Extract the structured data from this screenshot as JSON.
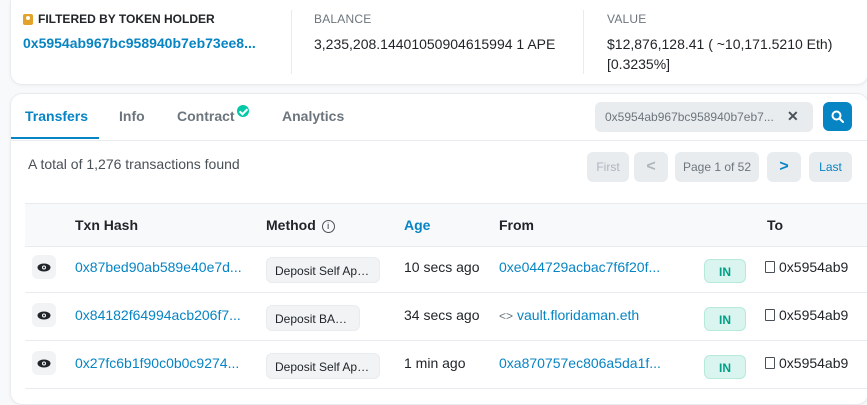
{
  "summary": {
    "holder_label": "FILTERED BY TOKEN HOLDER",
    "holder_address": "0x5954ab967bc958940b7eb73ee8...",
    "balance_label": "BALANCE",
    "balance_value": "3,235,208.14401050904615994 1 APE",
    "value_label": "VALUE",
    "value_line1": "$12,876,128.41 ( ~10,171.5210 Eth)",
    "value_line2": "[0.3235%]"
  },
  "tabs": [
    {
      "label": "Transfers",
      "active": true
    },
    {
      "label": "Info"
    },
    {
      "label": "Contract"
    },
    {
      "label": "Analytics"
    }
  ],
  "search": {
    "value": "0x5954ab967bc958940b7eb7..."
  },
  "total_text": "A total of 1,276 transactions found",
  "pagination": {
    "first": "First",
    "prev": "<",
    "page": "Page 1 of 52",
    "next": ">",
    "last": "Last"
  },
  "table": {
    "headers": {
      "txn_hash": "Txn Hash",
      "method": "Method",
      "age": "Age",
      "from": "From",
      "to": "To"
    },
    "rows": [
      {
        "hash": "0x87bed90ab589e40e7d...",
        "method": "Deposit Self Ape...",
        "age": "10 secs ago",
        "from": "0xe044729acbac7f6f20f...",
        "direction": "IN",
        "to": "0x5954ab9"
      },
      {
        "hash": "0x84182f64994acb206f7...",
        "method": "Deposit BAKC",
        "age": "34 secs ago",
        "from": "vault.floridaman.eth",
        "direction": "IN",
        "to": "0x5954ab9"
      },
      {
        "hash": "0x27fc6b1f90c0b0c9274...",
        "method": "Deposit Self Ape...",
        "age": "1 min ago",
        "from": "0xa870757ec806a5da1f...",
        "direction": "IN",
        "to": "0x5954ab9"
      }
    ]
  },
  "colors": {
    "accent": "#0784c3",
    "in_badge": "#00a186",
    "holder_icon": "#e3a22a"
  }
}
